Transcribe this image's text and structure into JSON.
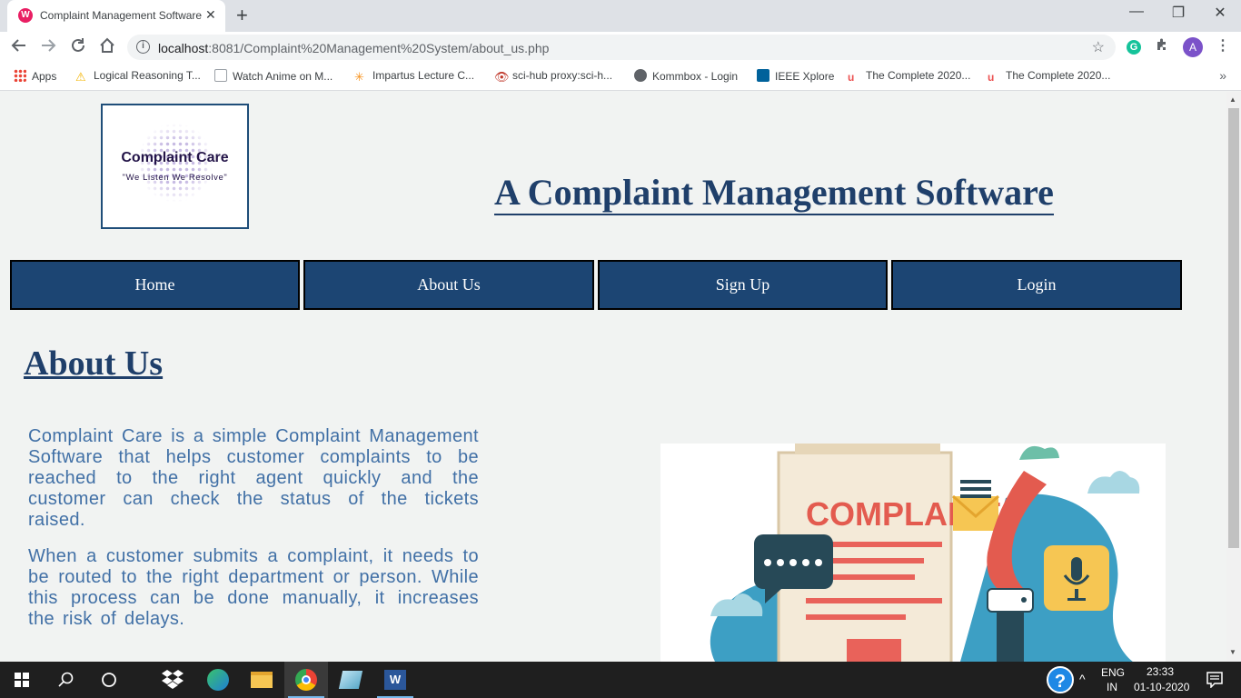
{
  "browser": {
    "tab_title": "Complaint Management Software",
    "tab_favicon_letter": "W",
    "url_host": "localhost",
    "url_path": ":8081/Complaint%20Management%20System/about_us.php",
    "bookmarks": [
      "Apps",
      "Logical Reasoning T...",
      "Watch Anime on M...",
      "Impartus Lecture C...",
      "sci-hub proxy:sci-h...",
      "Kommbox - Login",
      "IEEE Xplore",
      "The Complete 2020...",
      "The Complete 2020..."
    ],
    "avatar_letter": "A",
    "extension_letter": "G"
  },
  "logo": {
    "name": "Complaint Care",
    "tagline": "\"We Listen We Resolve\""
  },
  "header": {
    "title": "A Complaint Management Software"
  },
  "nav": {
    "items": [
      "Home",
      "About Us",
      "Sign Up",
      "Login"
    ]
  },
  "main": {
    "heading": "About Us",
    "paragraphs": [
      "Complaint Care is a simple Complaint Management Software that helps customer complaints to be reached to the right agent quickly and the customer can check the status of the tickets raised.",
      "When a customer submits a complaint, it needs to be routed to the right department or person. While this process can be done manually, it increases the risk of delays."
    ],
    "illustration_text": "COMPLAINT"
  },
  "taskbar": {
    "lang_1": "ENG",
    "lang_2": "IN",
    "time": "23:33",
    "date": "01-10-2020"
  },
  "colors": {
    "nav_bg": "#1c4573",
    "title": "#1f3f6a",
    "paragraph": "#4170a6",
    "page_bg": "#f1f3f2"
  }
}
